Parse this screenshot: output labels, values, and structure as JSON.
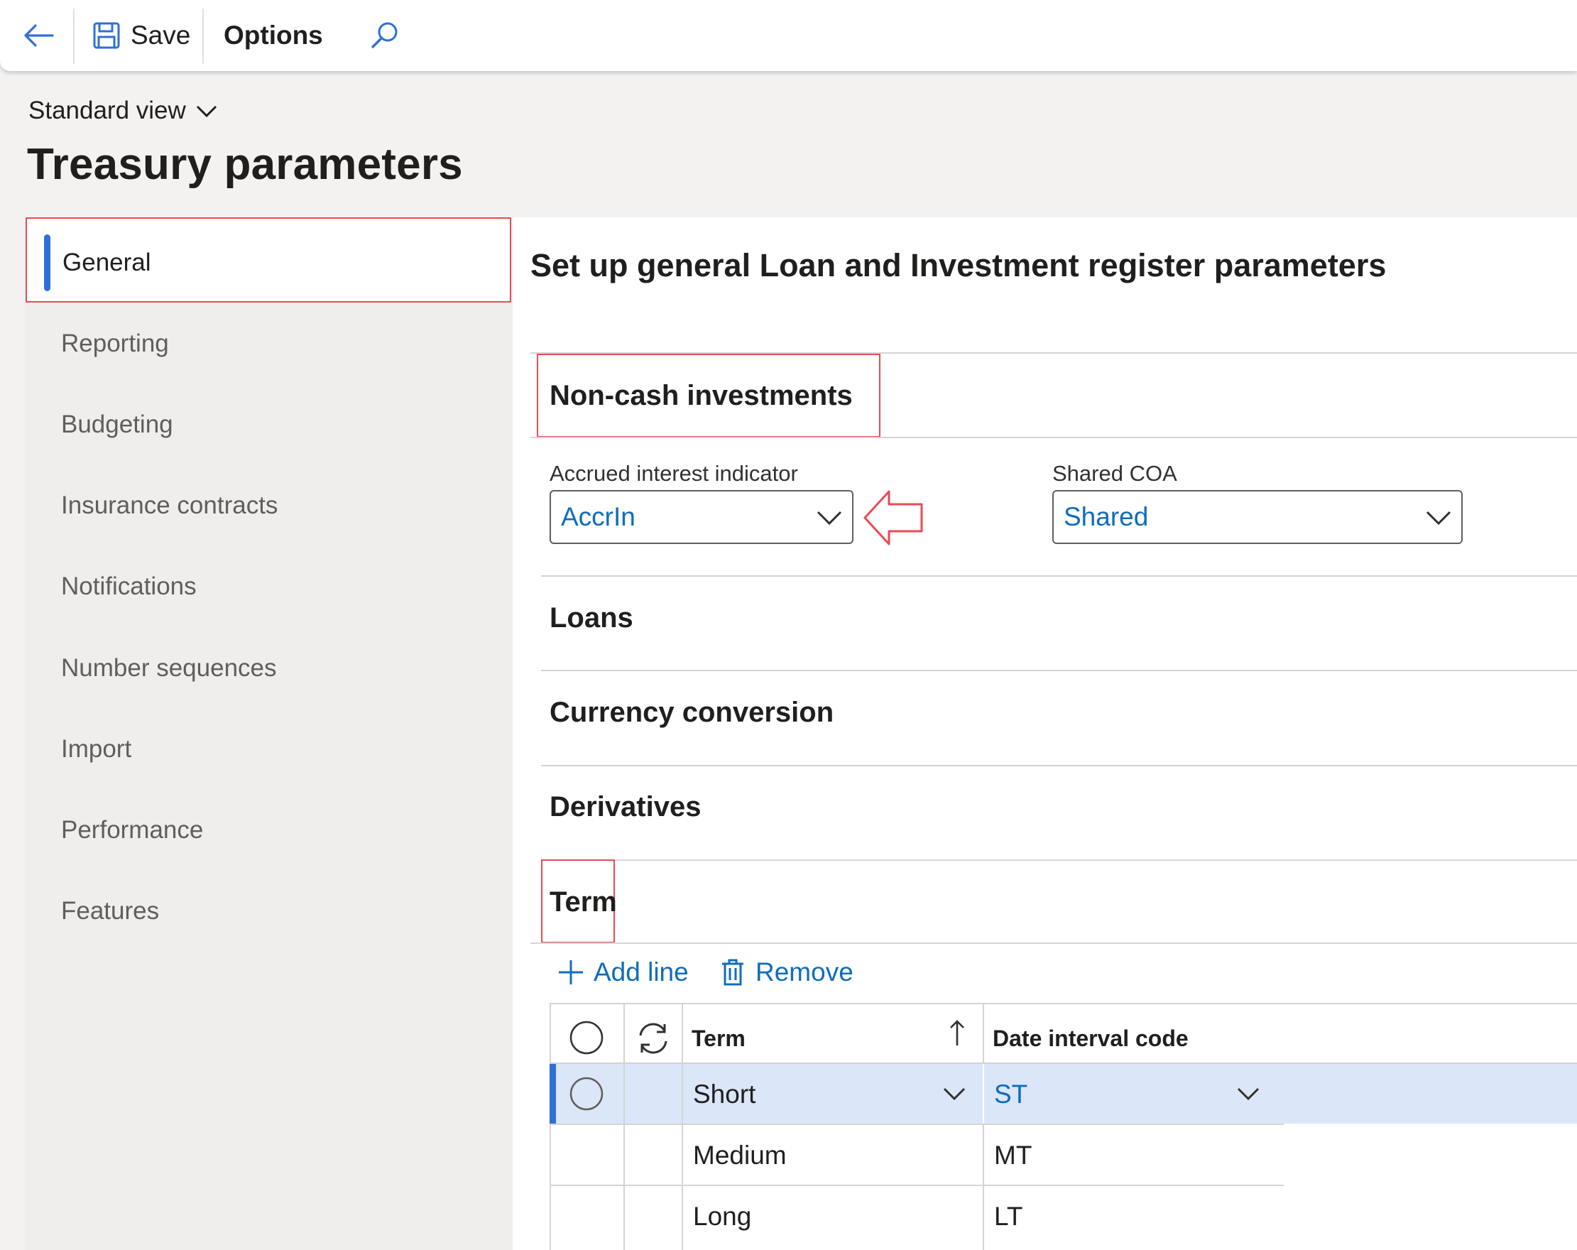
{
  "toolbar": {
    "save_label": "Save",
    "options_label": "Options"
  },
  "header": {
    "view_selector": "Standard view",
    "page_title": "Treasury parameters"
  },
  "sidebar": {
    "items": [
      {
        "label": "General",
        "active": true
      },
      {
        "label": "Reporting"
      },
      {
        "label": "Budgeting"
      },
      {
        "label": "Insurance contracts"
      },
      {
        "label": "Notifications"
      },
      {
        "label": "Number sequences"
      },
      {
        "label": "Import"
      },
      {
        "label": "Performance"
      },
      {
        "label": "Features"
      }
    ]
  },
  "main": {
    "heading": "Set up general Loan and Investment register parameters",
    "sections": {
      "noncash": "Non-cash investments",
      "loans": "Loans",
      "currency": "Currency conversion",
      "derivatives": "Derivatives",
      "term": "Term"
    },
    "fields": {
      "accrued_label": "Accrued interest indicator",
      "accrued_value": "AccrIn",
      "shared_label": "Shared COA",
      "shared_value": "Shared"
    },
    "term_actions": {
      "add_line": "Add line",
      "remove": "Remove"
    },
    "term_grid": {
      "columns": [
        "Term",
        "Date interval code"
      ],
      "rows": [
        {
          "term": "Short",
          "code": "ST",
          "selected": true
        },
        {
          "term": "Medium",
          "code": "MT"
        },
        {
          "term": "Long",
          "code": "LT"
        }
      ]
    }
  },
  "colors": {
    "accent": "#2f6fd8",
    "link": "#0f6cbd",
    "highlight_box": "#e84b54",
    "selected_row": "#dbe6f8"
  }
}
